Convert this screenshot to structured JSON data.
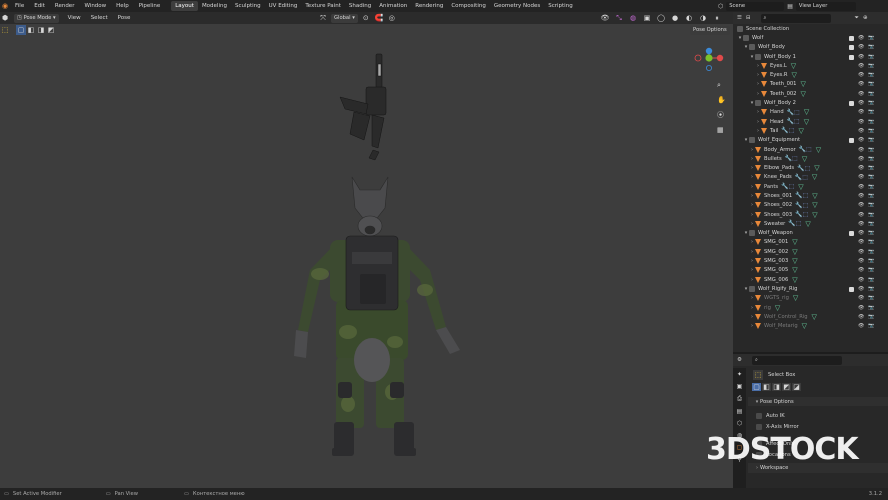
{
  "topbar": {
    "menus": [
      "File",
      "Edit",
      "Render",
      "Window",
      "Help",
      "Pipeline"
    ],
    "tabs": [
      "Layout",
      "Modeling",
      "Sculpting",
      "UV Editing",
      "Texture Paint",
      "Shading",
      "Animation",
      "Rendering",
      "Compositing",
      "Geometry Nodes",
      "Scripting"
    ],
    "active_tab": "Layout",
    "scene_label": "Scene",
    "view_layer_label": "View Layer"
  },
  "viewport": {
    "mode": "Pose Mode",
    "menus": [
      "View",
      "Select",
      "Pose"
    ],
    "orientation": "Global",
    "pose_options": "Pose Options",
    "background": "#3d3d3d"
  },
  "outliner": {
    "search_placeholder": "",
    "scene_collection": "Scene Collection",
    "rows": [
      {
        "indent": 0,
        "kind": "col",
        "label": "Wolf"
      },
      {
        "indent": 1,
        "kind": "col",
        "label": "Wolf_Body"
      },
      {
        "indent": 2,
        "kind": "col",
        "label": "Wolf_Body 1"
      },
      {
        "indent": 3,
        "kind": "obj",
        "label": "Eyes.L",
        "mods": "",
        "dim": false
      },
      {
        "indent": 3,
        "kind": "obj",
        "label": "Eyes.R",
        "mods": "",
        "dim": false
      },
      {
        "indent": 3,
        "kind": "obj",
        "label": "Teeth_001",
        "mods": "",
        "dim": false
      },
      {
        "indent": 3,
        "kind": "obj",
        "label": "Teeth_002",
        "mods": "",
        "dim": false
      },
      {
        "indent": 2,
        "kind": "col",
        "label": "Wolf_Body 2"
      },
      {
        "indent": 3,
        "kind": "obj",
        "label": "Hand",
        "mods": "mod",
        "dim": false
      },
      {
        "indent": 3,
        "kind": "obj",
        "label": "Head",
        "mods": "mod",
        "dim": false
      },
      {
        "indent": 3,
        "kind": "obj",
        "label": "Tail",
        "mods": "mod",
        "dim": false
      },
      {
        "indent": 1,
        "kind": "col",
        "label": "Wolf_Equipment"
      },
      {
        "indent": 2,
        "kind": "obj",
        "label": "Body_Armor",
        "mods": "mod",
        "dim": false
      },
      {
        "indent": 2,
        "kind": "obj",
        "label": "Bullets",
        "mods": "mod",
        "dim": false
      },
      {
        "indent": 2,
        "kind": "obj",
        "label": "Elbow_Pads",
        "mods": "mod",
        "dim": false
      },
      {
        "indent": 2,
        "kind": "obj",
        "label": "Knee_Pads",
        "mods": "mod",
        "dim": false
      },
      {
        "indent": 2,
        "kind": "obj",
        "label": "Pants",
        "mods": "mod",
        "dim": false
      },
      {
        "indent": 2,
        "kind": "obj",
        "label": "Shoes_001",
        "mods": "mod",
        "dim": false
      },
      {
        "indent": 2,
        "kind": "obj",
        "label": "Shoes_002",
        "mods": "mod",
        "dim": false
      },
      {
        "indent": 2,
        "kind": "obj",
        "label": "Shoes_003",
        "mods": "mod",
        "dim": false
      },
      {
        "indent": 2,
        "kind": "obj",
        "label": "Sweater",
        "mods": "mod",
        "dim": false
      },
      {
        "indent": 1,
        "kind": "col",
        "label": "Wolf_Weapon"
      },
      {
        "indent": 2,
        "kind": "obj",
        "label": "SMG_001",
        "mods": "",
        "dim": false
      },
      {
        "indent": 2,
        "kind": "obj",
        "label": "SMG_002",
        "mods": "",
        "dim": false
      },
      {
        "indent": 2,
        "kind": "obj",
        "label": "SMG_003",
        "mods": "",
        "dim": false
      },
      {
        "indent": 2,
        "kind": "obj",
        "label": "SMG_005",
        "mods": "",
        "dim": false
      },
      {
        "indent": 2,
        "kind": "obj",
        "label": "SMG_006",
        "mods": "",
        "dim": false
      },
      {
        "indent": 1,
        "kind": "col",
        "label": "Wolf_Rigify_Rig"
      },
      {
        "indent": 2,
        "kind": "obj",
        "label": "WGTS_rig",
        "mods": "",
        "dim": true
      },
      {
        "indent": 2,
        "kind": "obj",
        "label": "rig",
        "mods": "",
        "dim": true
      },
      {
        "indent": 2,
        "kind": "obj",
        "label": "Wolf_Control_Rig",
        "mods": "",
        "dim": true
      },
      {
        "indent": 2,
        "kind": "obj",
        "label": "Wolf_Metarig",
        "mods": "",
        "dim": true
      }
    ]
  },
  "properties": {
    "tool": "Select Box",
    "section_pose_options": "Pose Options",
    "auto_ik": "Auto IK",
    "x_axis_mirror": "X-Axis Mirror",
    "affect_only": "Affect Only",
    "locations": "Locations",
    "section_workspace": "Workspace"
  },
  "statusbar": {
    "item1": "Set Active Modifier",
    "item2": "Pan View",
    "item3": "Контекстное меню",
    "version": "3.1.2"
  },
  "watermark": "3DSTOCK"
}
